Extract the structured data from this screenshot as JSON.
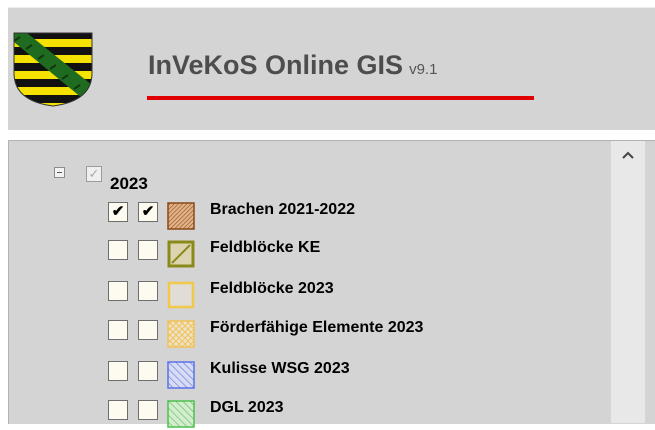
{
  "header": {
    "title": "InVeKoS Online GIS",
    "version": "v9.1",
    "accent_color": "#e10000",
    "logo": "saxony-coat-of-arms"
  },
  "tree": {
    "toggle_icon": "minus-box-icon",
    "year": {
      "label": "2023",
      "checked": true,
      "enabled": false
    },
    "layers": [
      {
        "label": "Brachen 2021-2022",
        "check1": true,
        "check2": true,
        "swatch": "brown-hatched"
      },
      {
        "label": "Feldblöcke KE",
        "check1": false,
        "check2": false,
        "swatch": "olive-outline-diagonal"
      },
      {
        "label": "Feldblöcke 2023",
        "check1": false,
        "check2": false,
        "swatch": "yellow-outline"
      },
      {
        "label": "Förderfähige Elemente 2023",
        "check1": false,
        "check2": false,
        "swatch": "yellow-crosshatch"
      },
      {
        "label": "Kulisse WSG 2023",
        "check1": false,
        "check2": false,
        "swatch": "blue-hatched"
      },
      {
        "label": "DGL 2023",
        "check1": false,
        "check2": false,
        "swatch": "green-hatched"
      }
    ]
  },
  "scrollbar": {
    "up_icon": "chevron-up-icon"
  }
}
